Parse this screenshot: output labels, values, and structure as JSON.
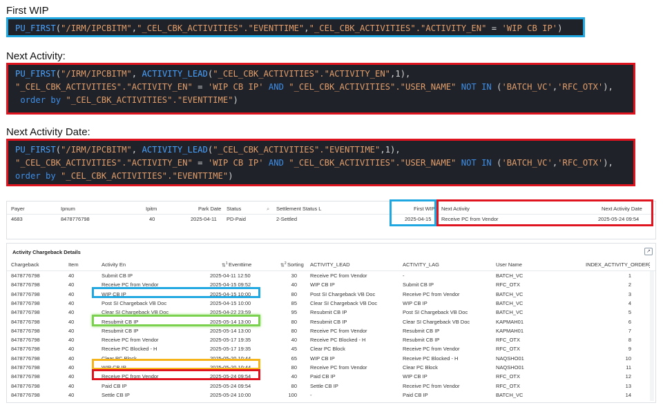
{
  "headings": {
    "first_wip": "First WIP",
    "next_activity": "Next Activity:",
    "next_activity_date": "Next Activity Date:"
  },
  "code": {
    "first_wip": [
      [
        [
          "func",
          "PU_FIRST"
        ],
        [
          "op",
          "("
        ],
        [
          "str",
          "\"/IRM/IPCBITM\""
        ],
        [
          "op",
          ","
        ],
        [
          "str",
          "\"_CEL_CBK_ACTIVITIES\".\"EVENTTIME\""
        ],
        [
          "op",
          ","
        ],
        [
          "str",
          "\"_CEL_CBK_ACTIVITIES\".\"ACTIVITY_EN\""
        ],
        [
          "op",
          " = "
        ],
        [
          "str",
          "'WIP CB IP'"
        ],
        [
          "op",
          ")"
        ]
      ]
    ],
    "next_activity": [
      [
        [
          "func",
          "PU_FIRST"
        ],
        [
          "op",
          "("
        ],
        [
          "str",
          "\"/IRM/IPCBITM\""
        ],
        [
          "op",
          ", "
        ],
        [
          "func",
          "ACTIVITY_LEAD"
        ],
        [
          "op",
          "("
        ],
        [
          "str",
          "\"_CEL_CBK_ACTIVITIES\".\"ACTIVITY_EN\""
        ],
        [
          "op",
          ","
        ],
        [
          "num",
          "1"
        ],
        [
          "op",
          "),"
        ]
      ],
      [
        [
          "str",
          "\"_CEL_CBK_ACTIVITIES\".\"ACTIVITY_EN\""
        ],
        [
          "op",
          " = "
        ],
        [
          "str",
          "'WIP CB IP'"
        ],
        [
          "op",
          " "
        ],
        [
          "kw",
          "AND"
        ],
        [
          "op",
          " "
        ],
        [
          "str",
          "\"_CEL_CBK_ACTIVITIES\".\"USER_NAME\""
        ],
        [
          "op",
          " "
        ],
        [
          "kw",
          "NOT IN"
        ],
        [
          "op",
          " ("
        ],
        [
          "str",
          "'BATCH_VC'"
        ],
        [
          "op",
          ","
        ],
        [
          "str",
          "'RFC_OTX'"
        ],
        [
          "op",
          "),"
        ]
      ],
      [
        [
          "op",
          " "
        ],
        [
          "kw",
          "order by"
        ],
        [
          "op",
          " "
        ],
        [
          "str",
          "\"_CEL_CBK_ACTIVITIES\".\"EVENTTIME\""
        ],
        [
          "op",
          ")"
        ]
      ]
    ],
    "next_activity_date": [
      [
        [
          "func",
          "PU_FIRST"
        ],
        [
          "op",
          "("
        ],
        [
          "str",
          "\"/IRM/IPCBITM\""
        ],
        [
          "op",
          ", "
        ],
        [
          "func",
          "ACTIVITY_LEAD"
        ],
        [
          "op",
          "("
        ],
        [
          "str",
          "\"_CEL_CBK_ACTIVITIES\".\"EVENTTIME\""
        ],
        [
          "op",
          ","
        ],
        [
          "num",
          "1"
        ],
        [
          "op",
          "),"
        ]
      ],
      [
        [
          "str",
          "\"_CEL_CBK_ACTIVITIES\".\"ACTIVITY_EN\""
        ],
        [
          "op",
          " = "
        ],
        [
          "str",
          "'WIP CB IP'"
        ],
        [
          "op",
          " "
        ],
        [
          "kw",
          "AND"
        ],
        [
          "op",
          " "
        ],
        [
          "str",
          "\"_CEL_CBK_ACTIVITIES\".\"USER_NAME\""
        ],
        [
          "op",
          " "
        ],
        [
          "kw",
          "NOT IN"
        ],
        [
          "op",
          " ("
        ],
        [
          "str",
          "'BATCH_VC'"
        ],
        [
          "op",
          ","
        ],
        [
          "str",
          "'RFC_OTX'"
        ],
        [
          "op",
          "),"
        ]
      ],
      [
        [
          "kw",
          "order by"
        ],
        [
          "op",
          " "
        ],
        [
          "str",
          "\"_CEL_CBK_ACTIVITIES\".\"EVENTTIME\""
        ],
        [
          "op",
          ")"
        ]
      ]
    ]
  },
  "summary": {
    "headers": [
      "Payer",
      "Ipnum",
      "Ipitm",
      "Park Date",
      "Status",
      "Settlement Status L",
      "First WIP",
      "Next Activity",
      "Next Activity Date"
    ],
    "values": [
      "4683",
      "8478776798",
      "40",
      "2025-04-11",
      "PD-Paid",
      "2-Settled",
      "2025-04-15",
      "Receive PC from Vendor",
      "2025-05-24 09:54"
    ]
  },
  "details": {
    "title": "Activity Chargeback Details",
    "expand_icon": "↗",
    "headers": [
      "Chargeback",
      "Item",
      "Activity En",
      "Eventtime",
      "Sorting",
      "ACTIVITY_LEAD",
      "ACTIVITY_LAG",
      "User Name",
      "INDEX_ACTIVITY_ORDER"
    ],
    "sort_badges": [
      "1",
      "2"
    ],
    "rows": [
      [
        "8478776798",
        "40",
        "Submit CB IP",
        "2025-04-11 12:50",
        "30",
        "Receive PC from Vendor",
        "-",
        "BATCH_VC",
        "1"
      ],
      [
        "8478776798",
        "40",
        "Receive PC from Vendor",
        "2025-04-15 09:52",
        "40",
        "WIP CB IP",
        "Submit CB IP",
        "RFC_OTX",
        "2"
      ],
      [
        "8478776798",
        "40",
        "WIP CB IP",
        "2025-04-15 10:00",
        "80",
        "Post SI Chargeback VB Doc",
        "Receive PC from Vendor",
        "BATCH_VC",
        "3"
      ],
      [
        "8478776798",
        "40",
        "Post SI Chargeback VB Doc",
        "2025-04-15 10:00",
        "85",
        "Clear SI Chargeback VB Doc",
        "WIP CB IP",
        "BATCH_VC",
        "4"
      ],
      [
        "8478776798",
        "40",
        "Clear SI Chargeback VB Doc",
        "2025-04-22 23:59",
        "95",
        "Resubmit CB IP",
        "Post SI Chargeback VB Doc",
        "BATCH_VC",
        "5"
      ],
      [
        "8478776798",
        "40",
        "Resubmit CB IP",
        "2025-05-14 13:00",
        "80",
        "Resubmit CB IP",
        "Clear SI Chargeback VB Doc",
        "KAPMAH01",
        "6"
      ],
      [
        "8478776798",
        "40",
        "Resubmit CB IP",
        "2025-05-14 13:00",
        "80",
        "Receive PC from Vendor",
        "Resubmit CB IP",
        "KAPMAH01",
        "7"
      ],
      [
        "8478776798",
        "40",
        "Receive PC from Vendor",
        "2025-05-17 19:35",
        "40",
        "Receive PC Blocked - H",
        "Resubmit CB IP",
        "RFC_OTX",
        "8"
      ],
      [
        "8478776798",
        "40",
        "Receive PC Blocked - H",
        "2025-05-17 19:35",
        "45",
        "Clear PC Block",
        "Receive PC from Vendor",
        "RFC_OTX",
        "9"
      ],
      [
        "8478776798",
        "40",
        "Clear PC Block",
        "2025-05-20 10:44",
        "65",
        "WIP CB IP",
        "Receive PC Blocked - H",
        "NAQSHO01",
        "10"
      ],
      [
        "8478776798",
        "40",
        "WIP CB IP",
        "2025-05-20 10:44",
        "80",
        "Receive PC from Vendor",
        "Clear PC Block",
        "NAQSHO01",
        "11"
      ],
      [
        "8478776798",
        "40",
        "Receive PC from Vendor",
        "2025-05-24 09:54",
        "40",
        "Paid CB IP",
        "WIP CB IP",
        "RFC_OTX",
        "12"
      ],
      [
        "8478776798",
        "40",
        "Paid CB IP",
        "2025-05-24 09:54",
        "80",
        "Settle CB IP",
        "Receive PC from Vendor",
        "RFC_OTX",
        "13"
      ],
      [
        "8478776798",
        "40",
        "Settle CB IP",
        "2025-05-24 10:00",
        "100",
        "-",
        "Paid CB IP",
        "BATCH_VC",
        "14"
      ]
    ]
  },
  "colors": {
    "highlight_blue": "#1ea7e1",
    "highlight_red": "#e0141e",
    "highlight_green": "#7ad14e",
    "highlight_orange": "#f4b41a"
  }
}
